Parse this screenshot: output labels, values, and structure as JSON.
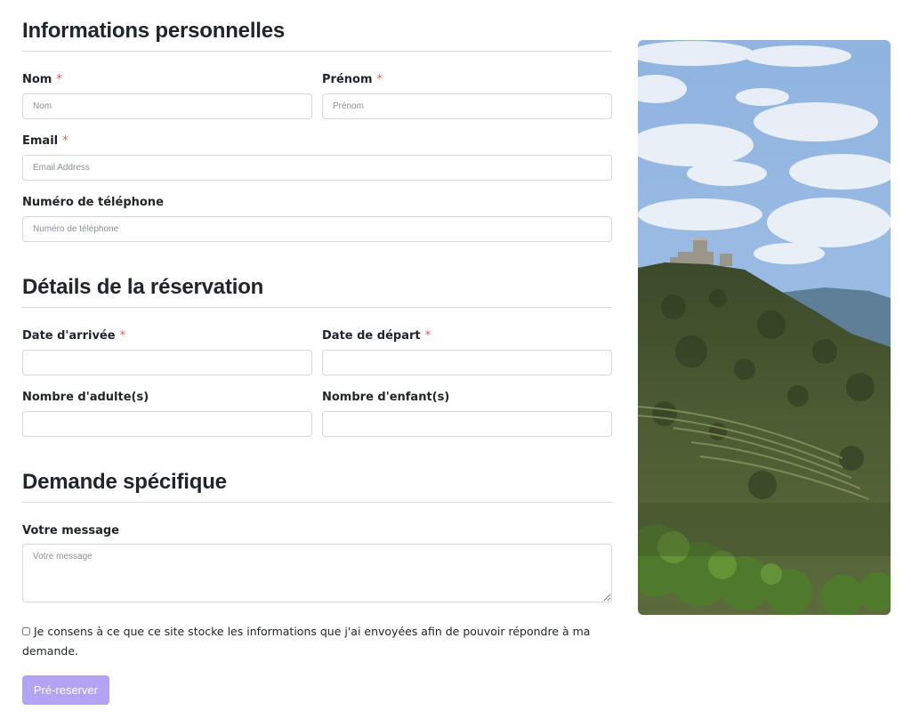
{
  "personal": {
    "title": "Informations personnelles",
    "nom_label": "Nom",
    "nom_placeholder": "Nom",
    "prenom_label": "Prénom",
    "prenom_placeholder": "Prénom",
    "email_label": "Email",
    "email_placeholder": "Email Address",
    "phone_label": "Numéro de téléphone",
    "phone_placeholder": "Numéro de téléphone",
    "required_mark": "*"
  },
  "booking": {
    "title": "Détails de la réservation",
    "arrival_label": "Date d'arrivée",
    "departure_label": "Date de départ",
    "adults_label": "Nombre d'adulte(s)",
    "children_label": "Nombre d'enfant(s)",
    "required_mark": "*"
  },
  "request": {
    "title": "Demande spécifique",
    "message_label": "Votre message",
    "message_placeholder": "Votre message"
  },
  "consent": {
    "text": "Je consens à ce que ce site stocke les informations que j'ai envoyées afin de pouvoir répondre à ma demande.",
    "checked": false
  },
  "submit_label": "Pré-reserver",
  "colors": {
    "button": "#b3a3f3",
    "required": "#e05a5a"
  },
  "photo": {
    "icon": "castle-hillside-photo"
  }
}
